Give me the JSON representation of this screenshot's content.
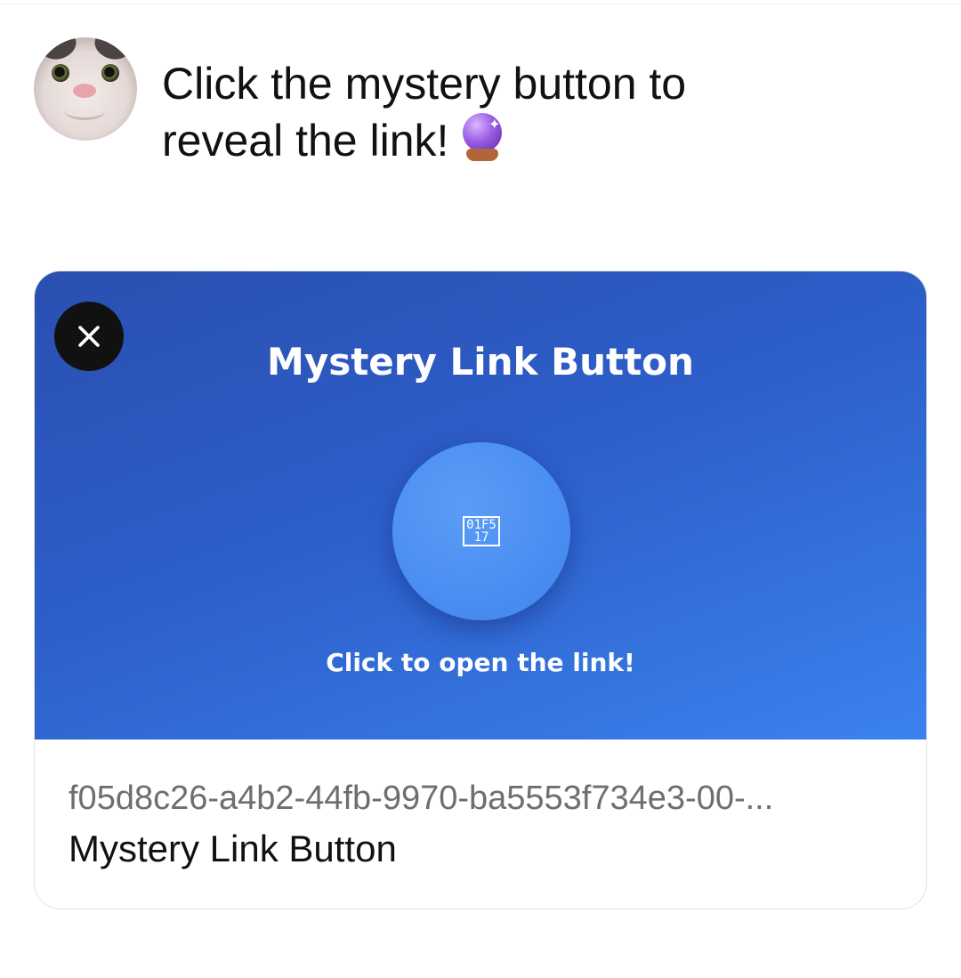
{
  "post": {
    "text": "Click the mystery button to reveal the link!",
    "emoji_icon": "crystal-ball-icon"
  },
  "link_preview": {
    "image_title": "Mystery Link Button",
    "button_glyph": "01F517",
    "image_caption": "Click to open the link!",
    "url": "f05d8c26-a4b2-44fb-9970-ba5553f734e3-00-...",
    "title": "Mystery Link Button",
    "close_icon": "close-icon"
  },
  "colors": {
    "preview_gradient_start": "#2a4fb0",
    "preview_gradient_end": "#3b82f0",
    "button_blue": "#4a8ef2",
    "close_button_bg": "#111111",
    "url_gray": "#6e6e6e"
  }
}
